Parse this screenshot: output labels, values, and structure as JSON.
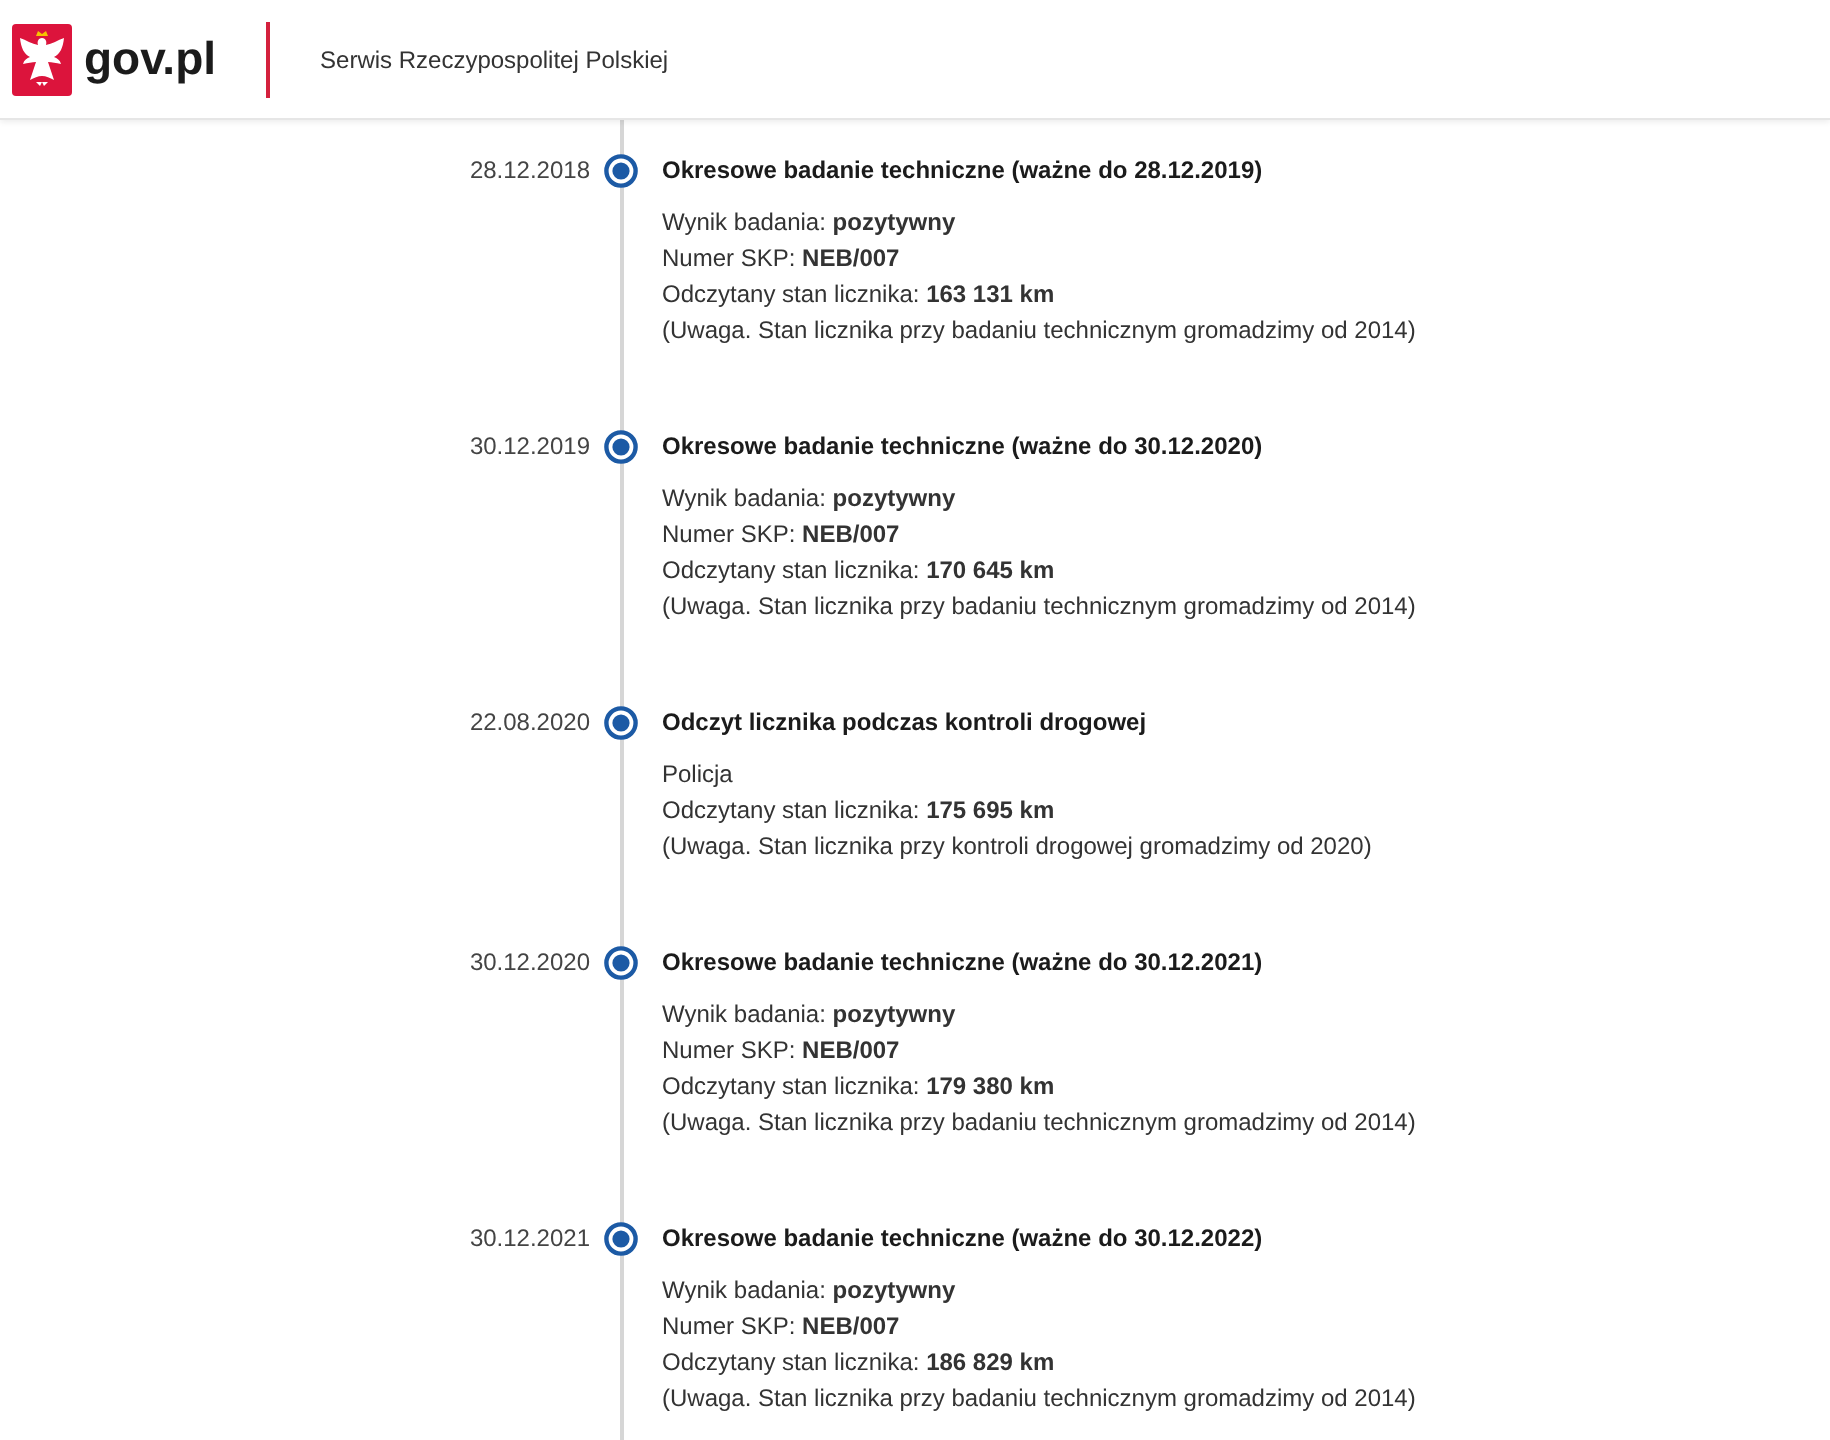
{
  "header": {
    "logo_text": "gov.pl",
    "subtitle": "Serwis Rzeczypospolitej Polskiej"
  },
  "timeline": [
    {
      "date": "28.12.2018",
      "title": "Okresowe badanie techniczne (ważne do 28.12.2019)",
      "lines": [
        "Wynik badania: **pozytywny**",
        "Numer SKP: **NEB/007**",
        "Odczytany stan licznika: **163 131 km**",
        "(Uwaga. Stan licznika przy badaniu technicznym gromadzimy od 2014)"
      ]
    },
    {
      "date": "30.12.2019",
      "title": "Okresowe badanie techniczne (ważne do 30.12.2020)",
      "lines": [
        "Wynik badania: **pozytywny**",
        "Numer SKP: **NEB/007**",
        "Odczytany stan licznika: **170 645 km**",
        "(Uwaga. Stan licznika przy badaniu technicznym gromadzimy od 2014)"
      ]
    },
    {
      "date": "22.08.2020",
      "title": "Odczyt licznika podczas kontroli drogowej",
      "lines": [
        "Policja",
        "Odczytany stan licznika: **175 695 km**",
        "(Uwaga. Stan licznika przy kontroli drogowej gromadzimy od 2020)"
      ]
    },
    {
      "date": "30.12.2020",
      "title": "Okresowe badanie techniczne (ważne do 30.12.2021)",
      "lines": [
        "Wynik badania: **pozytywny**",
        "Numer SKP: **NEB/007**",
        "Odczytany stan licznika: **179 380 km**",
        "(Uwaga. Stan licznika przy badaniu technicznym gromadzimy od 2014)"
      ]
    },
    {
      "date": "30.12.2021",
      "title": "Okresowe badanie techniczne (ważne do 30.12.2022)",
      "lines": [
        "Wynik badania: **pozytywny**",
        "Numer SKP: **NEB/007**",
        "Odczytany stan licznika: **186 829 km**",
        "(Uwaga. Stan licznika przy badaniu technicznym gromadzimy od 2014)"
      ]
    }
  ]
}
